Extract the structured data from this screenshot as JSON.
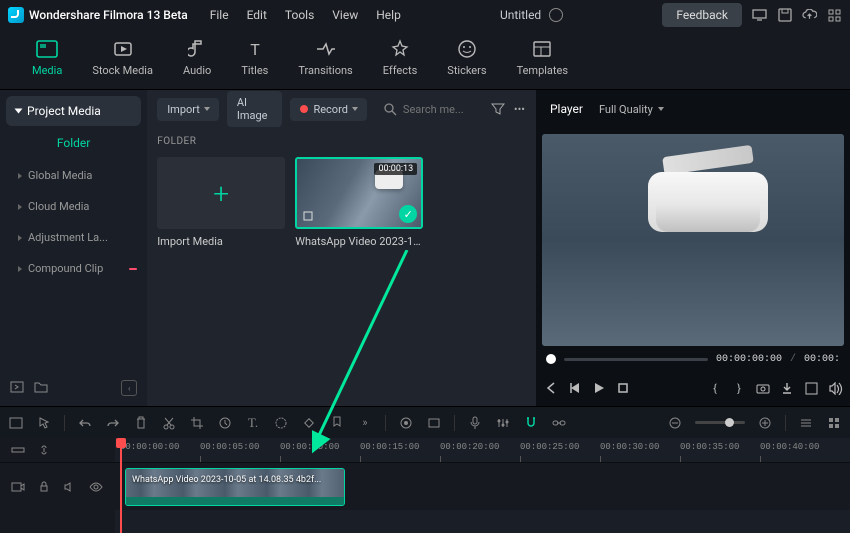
{
  "topbar": {
    "app_name": "Wondershare Filmora 13 Beta",
    "menu": [
      "File",
      "Edit",
      "Tools",
      "View",
      "Help"
    ],
    "title": "Untitled",
    "feedback": "Feedback"
  },
  "ribbon": [
    {
      "label": "Media",
      "active": true,
      "icon": "media"
    },
    {
      "label": "Stock Media",
      "active": false,
      "icon": "stock"
    },
    {
      "label": "Audio",
      "active": false,
      "icon": "audio"
    },
    {
      "label": "Titles",
      "active": false,
      "icon": "titles"
    },
    {
      "label": "Transitions",
      "active": false,
      "icon": "transitions"
    },
    {
      "label": "Effects",
      "active": false,
      "icon": "effects"
    },
    {
      "label": "Stickers",
      "active": false,
      "icon": "stickers"
    },
    {
      "label": "Templates",
      "active": false,
      "icon": "templates"
    }
  ],
  "sidebar": {
    "project_media": "Project Media",
    "folder": "Folder",
    "items": [
      {
        "label": "Global Media"
      },
      {
        "label": "Cloud Media"
      },
      {
        "label": "Adjustment La..."
      },
      {
        "label": "Compound Clip",
        "badge": true
      }
    ]
  },
  "mid": {
    "import": "Import",
    "ai_image": "AI Image",
    "record": "Record",
    "search_placeholder": "Search me...",
    "section": "FOLDER",
    "cards": [
      {
        "type": "import",
        "label": "Import Media"
      },
      {
        "type": "clip",
        "label": "WhatsApp Video 2023-10-05...",
        "duration": "00:00:13",
        "selected": true
      }
    ]
  },
  "preview": {
    "player": "Player",
    "quality": "Full Quality",
    "tc_current": "00:00:00:00",
    "tc_total": "00:00:"
  },
  "timeline": {
    "ticks": [
      "00:00:00:00",
      "00:00:05:00",
      "00:00:10:00",
      "00:00:15:00",
      "00:00:20:00",
      "00:00:25:00",
      "00:00:30:00",
      "00:00:35:00",
      "00:00:40:00"
    ],
    "clip_name": "WhatsApp Video 2023-10-05 at 14.08.35 4b2f..."
  }
}
